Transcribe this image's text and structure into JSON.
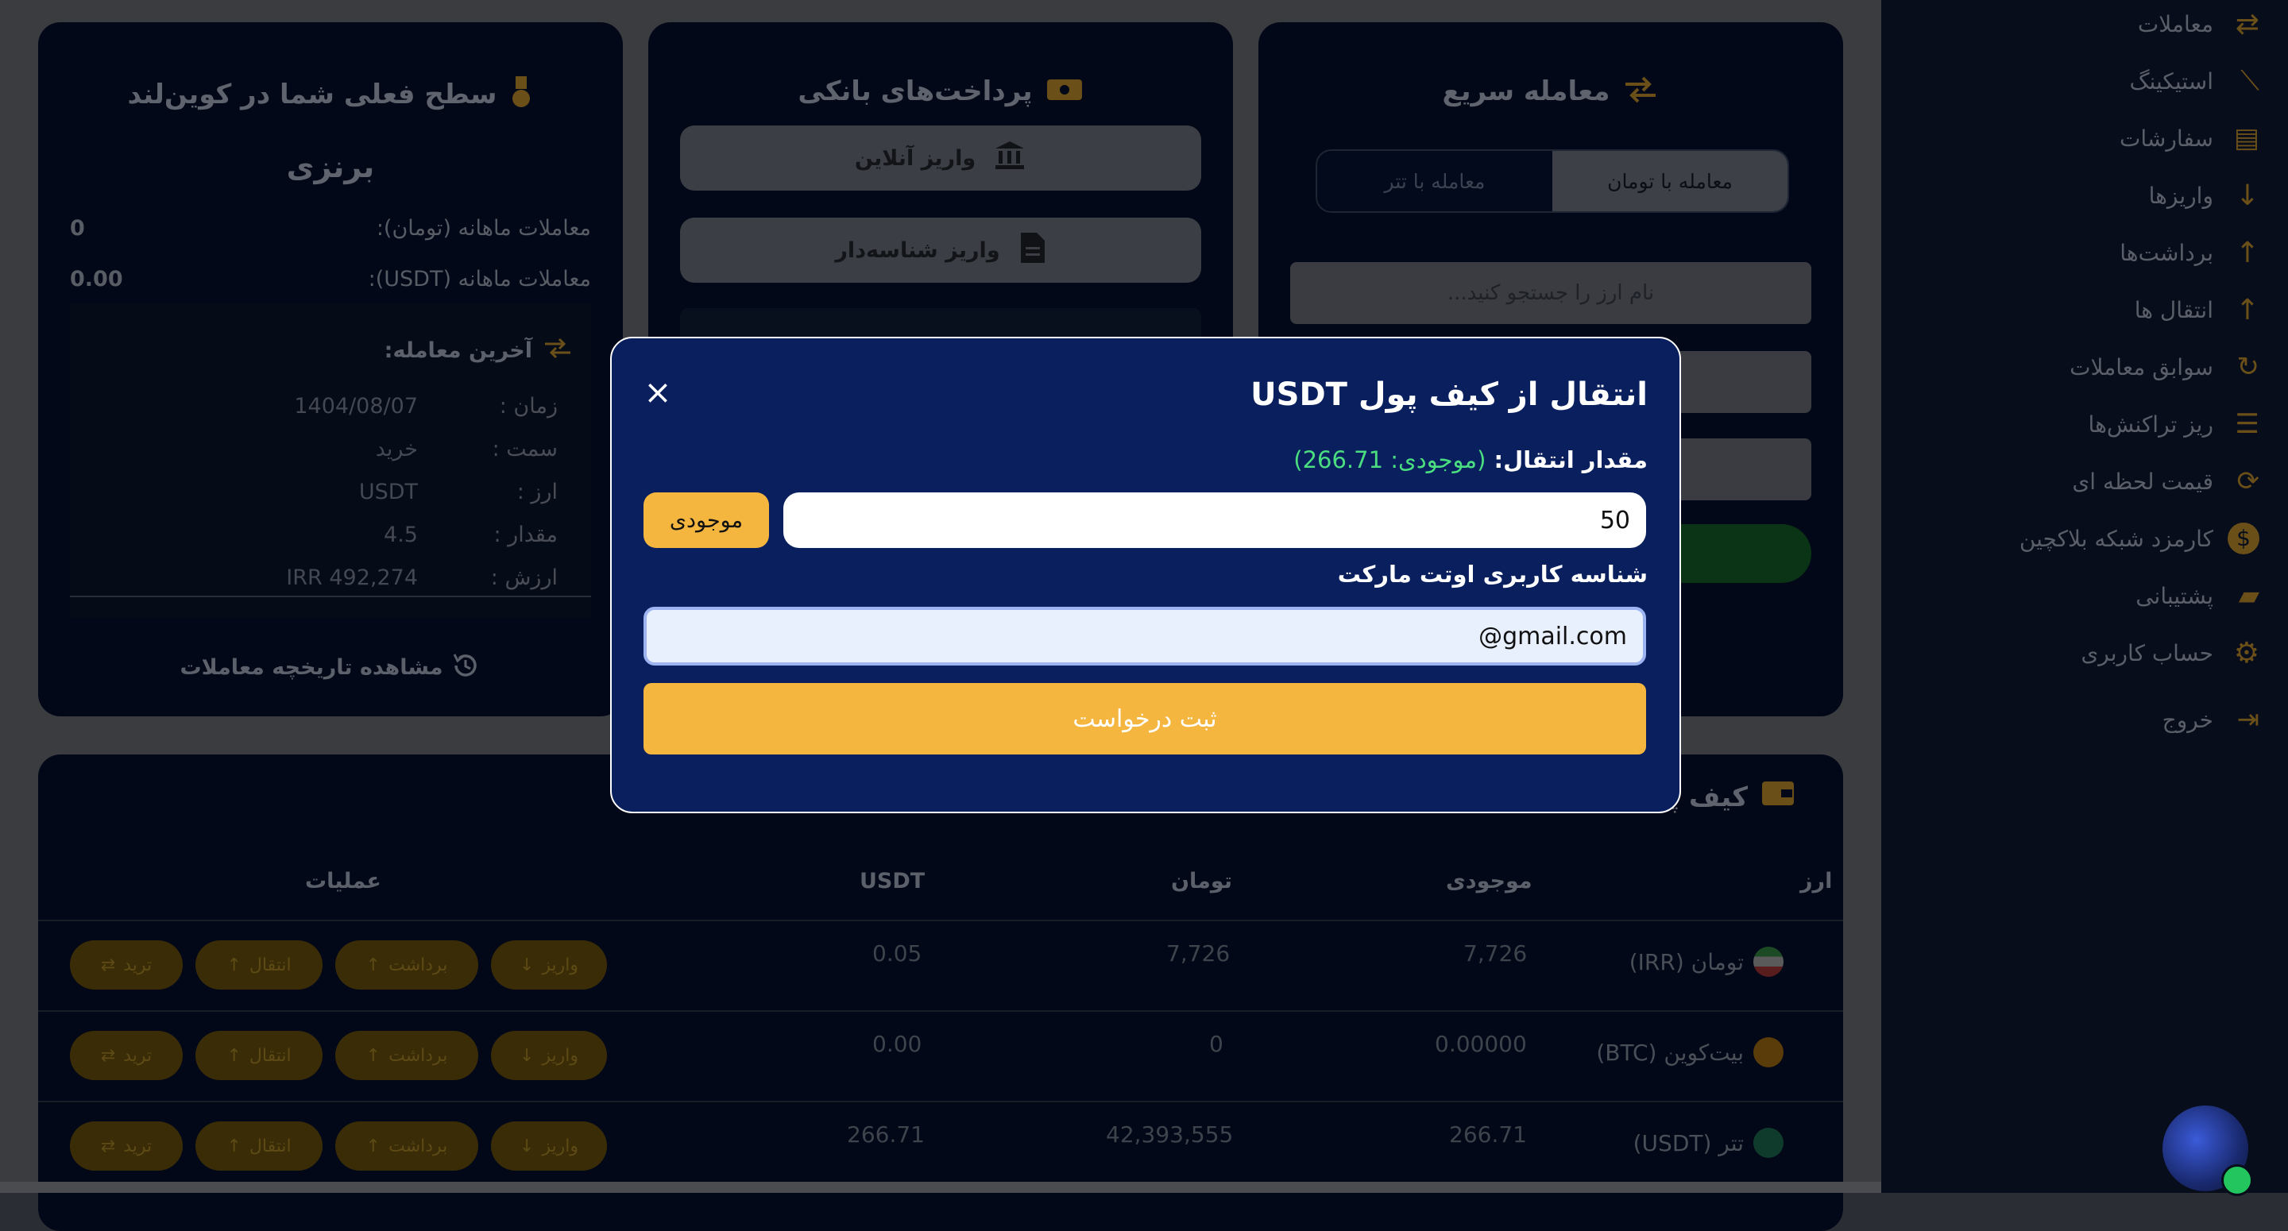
{
  "colors": {
    "modal_bg": "#0a1f5e",
    "accent": "#f4b63f",
    "balance_green": "#4ade80",
    "panel_bg": "#020817"
  },
  "quick_trade": {
    "title": "معامله سریع",
    "tabs": [
      {
        "label": "معامله با تومان",
        "active": true
      },
      {
        "label": "معامله با تتر",
        "active": false
      }
    ],
    "search_placeholder": "نام ارز را جستجو کنید..."
  },
  "bank_payments": {
    "title": "پرداخت‌های بانکی",
    "buttons": [
      {
        "label": "واریز آنلاین",
        "icon": "bank-icon"
      },
      {
        "label": "واریز شناسه‌دار",
        "icon": "document-icon"
      }
    ]
  },
  "level": {
    "title": "سطح فعلی شما در کوین‌لند",
    "level_name": "برنزی",
    "monthly_toman_label": "معاملات ماهانه (تومان):",
    "monthly_toman_value": "0",
    "monthly_usdt_label": "معاملات ماهانه (USDT):",
    "monthly_usdt_value": "0.00",
    "last_trade_title": "آخرین معامله:",
    "last_trade": [
      {
        "label": "زمان :",
        "value": "1404/08/07"
      },
      {
        "label": "سمت :",
        "value": "خرید"
      },
      {
        "label": "ارز :",
        "value": "USDT"
      },
      {
        "label": "مقدار :",
        "value": "4.5"
      },
      {
        "label": "ارزش :",
        "value": "IRR 492,274"
      }
    ],
    "history_link": "مشاهده تاریخچه معاملات"
  },
  "wallet": {
    "title": "کیف پول",
    "headers": [
      "ارز",
      "موجودی",
      "تومان",
      "USDT",
      "عملیات"
    ],
    "rows": [
      {
        "coin": "تومان (IRR)",
        "balance": "7,726",
        "toman": "7,726",
        "usdt": "0.05"
      },
      {
        "coin": "بیت‌کوین (BTC)",
        "balance": "0.00000",
        "toman": "0",
        "usdt": "0.00"
      },
      {
        "coin": "تتر (USDT)",
        "balance": "266.71",
        "toman": "42,393,555",
        "usdt": "266.71"
      }
    ],
    "actions": {
      "deposit": "واریز",
      "withdraw": "برداشت",
      "transfer": "انتقال",
      "trade": "ترید"
    }
  },
  "sidebar": {
    "items": [
      {
        "label": "معاملات",
        "icon": "swap-icon"
      },
      {
        "label": "استیکینگ",
        "icon": "chart-trend-icon"
      },
      {
        "label": "سفارشات",
        "icon": "clipboard-icon"
      },
      {
        "label": "واریزها",
        "icon": "arrow-down-icon"
      },
      {
        "label": "برداشت‌ها",
        "icon": "arrow-up-icon"
      },
      {
        "label": "انتقال ها",
        "icon": "arrow-up-icon"
      },
      {
        "label": "سوابق معاملات",
        "icon": "history-icon"
      },
      {
        "label": "ریز تراکنش‌ها",
        "icon": "list-icon"
      },
      {
        "label": "قیمت لحظه ای",
        "icon": "refresh-icon"
      },
      {
        "label": "کارمزد شبکه بلاکچین",
        "icon": "dollar-icon"
      },
      {
        "label": "پشتیبانی",
        "icon": "chat-icon"
      },
      {
        "label": "حساب کاربری",
        "icon": "gear-icon"
      },
      {
        "label": "خروج",
        "icon": "logout-icon"
      }
    ]
  },
  "modal": {
    "title": "انتقال از کیف پول USDT",
    "close": "×",
    "amount_label": "مقدار انتقال:",
    "balance_text": "(موجودی: 266.71)",
    "amount_value": "50",
    "max_button": "موجودی",
    "user_id_label": "شناسه کاربری اوتت مارکت",
    "user_id_value": "@gmail.com",
    "submit": "ثبت درخواست"
  }
}
